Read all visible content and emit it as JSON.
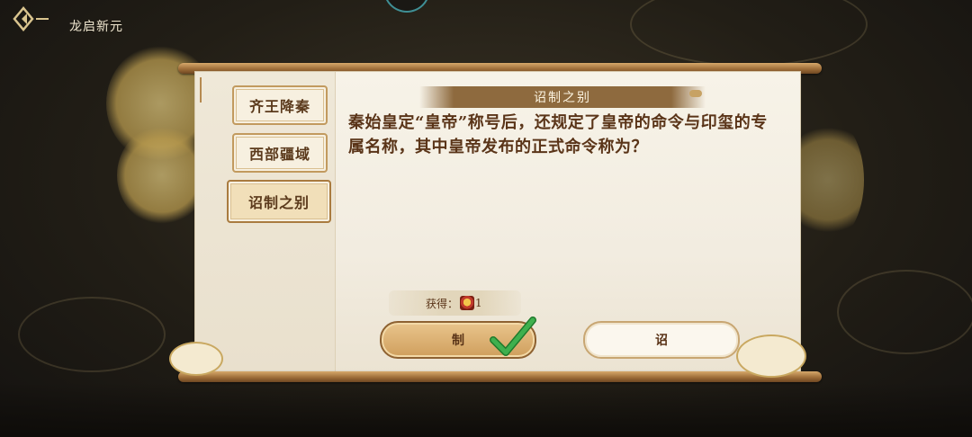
{
  "header": {
    "title": "龙启新元"
  },
  "tabs": [
    {
      "label": "齐王降秦",
      "active": false
    },
    {
      "label": "西部疆域",
      "active": false
    },
    {
      "label": "诏制之别",
      "active": true
    }
  ],
  "quiz": {
    "banner": "诏制之别",
    "question": "秦始皇定“皇帝”称号后，还规定了皇帝的命令与印玺的专属名称，其中皇帝发布的正式命令称为？",
    "reward_label": "获得：",
    "reward_count": "1",
    "answers": [
      {
        "label": "制",
        "selected": true,
        "correct": true
      },
      {
        "label": "诏",
        "selected": false
      }
    ]
  },
  "colors": {
    "accent_brown": "#8e6a3e",
    "check_green": "#2f9a3c",
    "text_brown": "#5a3418"
  },
  "icons": [
    "back-arrow-icon",
    "reward-item-icon",
    "check-mark-icon"
  ]
}
